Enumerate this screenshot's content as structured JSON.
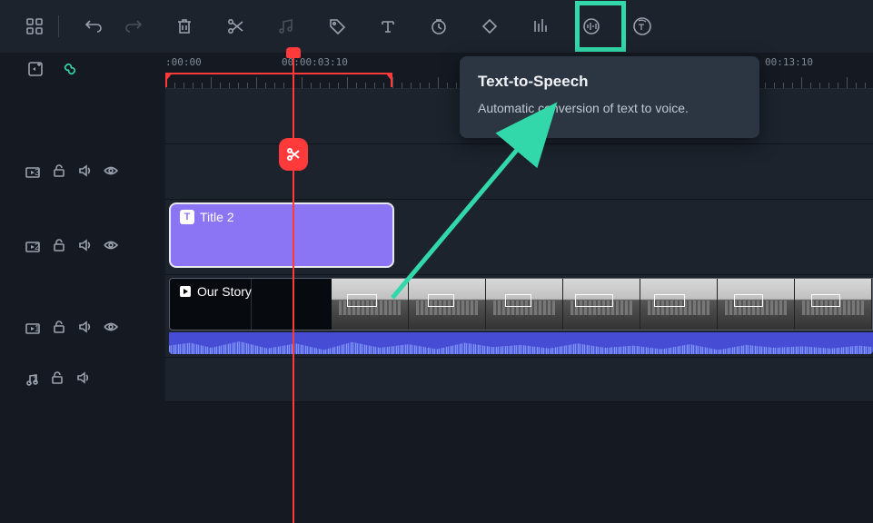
{
  "toolbar": {
    "items": [
      {
        "name": "apps-icon"
      },
      {
        "name": "undo-icon"
      },
      {
        "name": "redo-icon",
        "disabled": true
      },
      {
        "name": "trash-icon"
      },
      {
        "name": "scissors-icon"
      },
      {
        "name": "music-note-icon",
        "disabled": true
      },
      {
        "name": "tag-icon"
      },
      {
        "name": "text-icon"
      },
      {
        "name": "clock-icon"
      },
      {
        "name": "diamond-icon"
      },
      {
        "name": "equalizer-icon"
      },
      {
        "name": "audio-levels-icon"
      },
      {
        "name": "tts-icon",
        "highlighted": true
      }
    ]
  },
  "highlight": {
    "target": "tts-icon"
  },
  "tooltip": {
    "title": "Text-to-Speech",
    "body": "Automatic conversion of text to voice."
  },
  "ruler": {
    "timestamps": [
      ":00:00",
      "00:00:03:10",
      "00:13:10"
    ],
    "red_in_out": true
  },
  "playhead": {
    "position": "00:00:03:10"
  },
  "controls_header": {
    "add_track": "add-track",
    "link": "link"
  },
  "tracks": [
    {
      "icon": "video-icon",
      "index": "3",
      "lock": "unlocked",
      "mute": "audible",
      "visible": "visible",
      "clips": []
    },
    {
      "icon": "video-icon",
      "index": "2",
      "lock": "unlocked",
      "mute": "audible",
      "visible": "visible",
      "clips": [
        {
          "type": "title",
          "label": "Title 2"
        }
      ]
    },
    {
      "icon": "video-icon",
      "index": "1",
      "lock": "unlocked",
      "mute": "audible",
      "visible": "visible",
      "clips": [
        {
          "type": "video",
          "label": "Our Story"
        }
      ]
    },
    {
      "icon": "music-icon",
      "index": "1",
      "lock": "unlocked",
      "mute": "audible",
      "visible": null,
      "clips": []
    }
  ],
  "colors": {
    "accent": "#33d8aa",
    "playhead": "#ff3a3a",
    "title_clip": "#8b75f5",
    "audio_wave": "#3a3fcf"
  }
}
